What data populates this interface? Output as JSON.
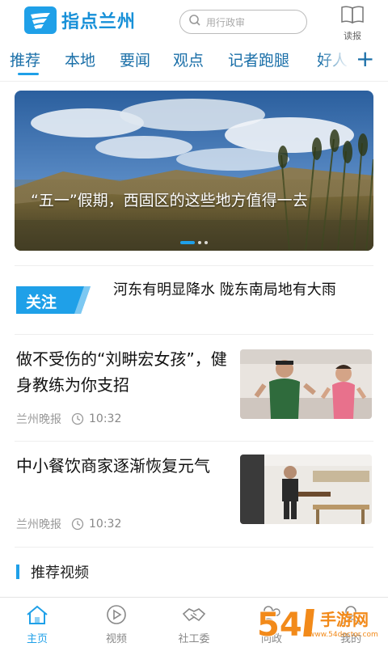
{
  "header": {
    "logo_text": "指点兰州",
    "search_placeholder": "用行政审",
    "read_label": "读报"
  },
  "tabs": [
    {
      "label": "推荐",
      "active": true
    },
    {
      "label": "本地"
    },
    {
      "label": "要闻"
    },
    {
      "label": "观点"
    },
    {
      "label": "记者跑腿"
    },
    {
      "label": "好人"
    }
  ],
  "banner": {
    "title": "“五一”假期，西固区的这些地方值得一去"
  },
  "focus": {
    "badge": "关注",
    "text": "河东有明显降水 陇东南局地有大雨"
  },
  "news": [
    {
      "title": "做不受伤的“刘畊宏女孩”，健身教练为你支招",
      "source": "兰州晚报",
      "time": "10:32"
    },
    {
      "title": "中小餐饮商家逐渐恢复元气",
      "source": "兰州晚报",
      "time": "10:32"
    }
  ],
  "section": {
    "title": "推荐视频"
  },
  "bottom_nav": [
    {
      "label": "主页",
      "icon": "home-icon",
      "active": true
    },
    {
      "label": "视频",
      "icon": "play-icon"
    },
    {
      "label": "社工委",
      "icon": "handshake-icon"
    },
    {
      "label": "问政",
      "icon": "people-icon"
    },
    {
      "label": "我的",
      "icon": "user-icon"
    }
  ],
  "watermark": {
    "text": "手游网",
    "url": "www.54doctor.com",
    "number": "54"
  },
  "colors": {
    "accent": "#1fa0e8",
    "tab_text": "#1a6fa8",
    "meta": "#999999"
  }
}
